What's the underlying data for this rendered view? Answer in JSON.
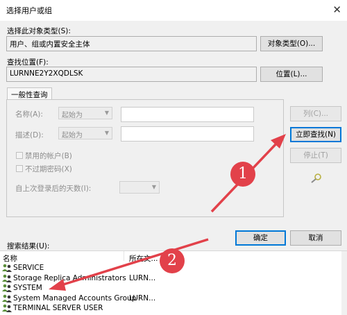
{
  "window": {
    "title": "选择用户或组",
    "close_glyph": "✕"
  },
  "object_type": {
    "label": "选择此对象类型(S):",
    "value": "用户、组或内置安全主体",
    "button": "对象类型(O)..."
  },
  "location": {
    "label": "查找位置(F):",
    "value": "LURNNE2Y2XQDLSK",
    "button": "位置(L)..."
  },
  "general_query": {
    "tab": "一般性查询",
    "name_label": "名称(A):",
    "name_mode": "起始为",
    "desc_label": "描述(D):",
    "desc_mode": "起始为",
    "disabled_accounts": "禁用的帐户(B)",
    "non_expiring_pw": "不过期密码(X)",
    "days_since_logon": "自上次登录后的天数(I):"
  },
  "buttons": {
    "columns": "列(C)...",
    "find_now": "立即查找(N)",
    "stop": "停止(T)",
    "ok": "确定",
    "cancel": "取消"
  },
  "results": {
    "label": "搜索结果(U):",
    "columns": [
      "名称",
      "所在文..."
    ],
    "rows": [
      {
        "name": "SERVICE",
        "location": ""
      },
      {
        "name": "Storage Replica Administrators",
        "location": "LURN..."
      },
      {
        "name": "SYSTEM",
        "location": ""
      },
      {
        "name": "System Managed Accounts Group",
        "location": "LURN..."
      },
      {
        "name": "TERMINAL SERVER USER",
        "location": ""
      }
    ]
  },
  "annotations": {
    "marker1": "1",
    "marker2": "2",
    "color": "#e2414a"
  }
}
